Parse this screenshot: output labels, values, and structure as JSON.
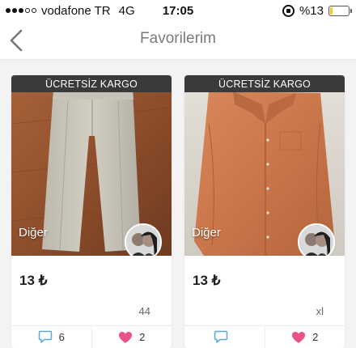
{
  "status_bar": {
    "carrier": "vodafone TR",
    "network": "4G",
    "time": "17:05",
    "battery_text": "%13",
    "battery_level": 0.13,
    "battery_color": "#f2cd1b"
  },
  "nav": {
    "title": "Favorilerim",
    "back_icon": "chevron-left-icon"
  },
  "products": [
    {
      "badge": "ÜCRETSİZ KARGO",
      "category": "Diğer",
      "price": "13 ₺",
      "size": "44",
      "comments": "6",
      "likes": "2"
    },
    {
      "badge": "ÜCRETSİZ KARGO",
      "category": "Diğer",
      "price": "13 ₺",
      "size": "xl",
      "comments": "",
      "likes": "2"
    }
  ],
  "colors": {
    "accent_heart": "#e8518a",
    "comment_icon": "#5aa9d6",
    "badge_bg": "#3a3a3a"
  }
}
